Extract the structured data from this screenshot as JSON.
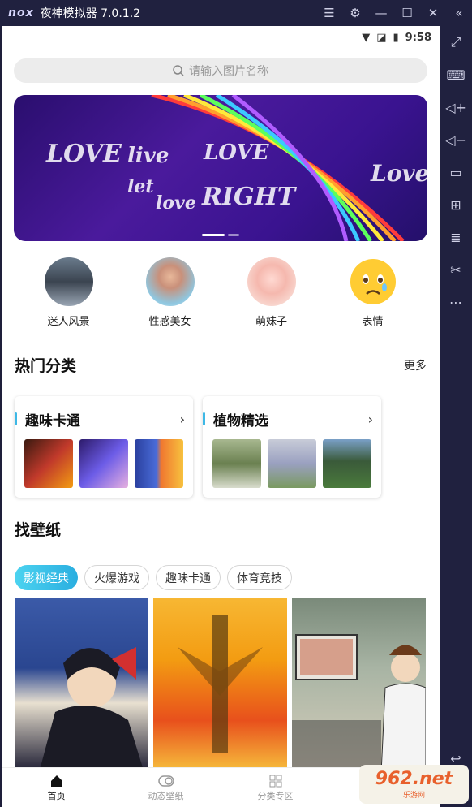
{
  "window": {
    "logo": "nox",
    "title": "夜神模拟器 7.0.1.2",
    "controls": [
      "menu-icon",
      "gear-icon",
      "minimize-icon",
      "maximize-icon",
      "close-icon",
      "collapse-icon"
    ]
  },
  "status": {
    "time": "9:58"
  },
  "search": {
    "placeholder": "请输入图片名称"
  },
  "banner": {
    "words": [
      "LOVE",
      "live",
      "let",
      "love",
      "RIGHT",
      "LOVE",
      "Love"
    ]
  },
  "categories": [
    {
      "label": "迷人风景",
      "icon": "landscape-avatar"
    },
    {
      "label": "性感美女",
      "icon": "girl-avatar"
    },
    {
      "label": "萌妹子",
      "icon": "piglet-avatar"
    },
    {
      "label": "表情",
      "icon": "emoji-avatar"
    }
  ],
  "hot": {
    "title": "热门分类",
    "more": "更多",
    "cards": [
      {
        "title": "趣味卡通",
        "colors": [
          "#c0392b",
          "#6c5ce7",
          "#e17055"
        ]
      },
      {
        "title": "植物精选",
        "colors": [
          "#8aa070",
          "#b5b8c8",
          "#4a7a3c"
        ]
      }
    ]
  },
  "find": {
    "title": "找壁纸",
    "chips": [
      "影视经典",
      "火爆游戏",
      "趣味卡通",
      "体育竞技"
    ]
  },
  "bottom_nav": [
    {
      "label": "首页",
      "icon": "home-icon"
    },
    {
      "label": "动态壁纸",
      "icon": "toggle-icon"
    },
    {
      "label": "分类专区",
      "icon": "grid-icon"
    }
  ],
  "watermark": {
    "big": "962.net",
    "small": "乐游网"
  },
  "colors": {
    "accent": "#2aaee0",
    "chrome": "#20213f"
  }
}
